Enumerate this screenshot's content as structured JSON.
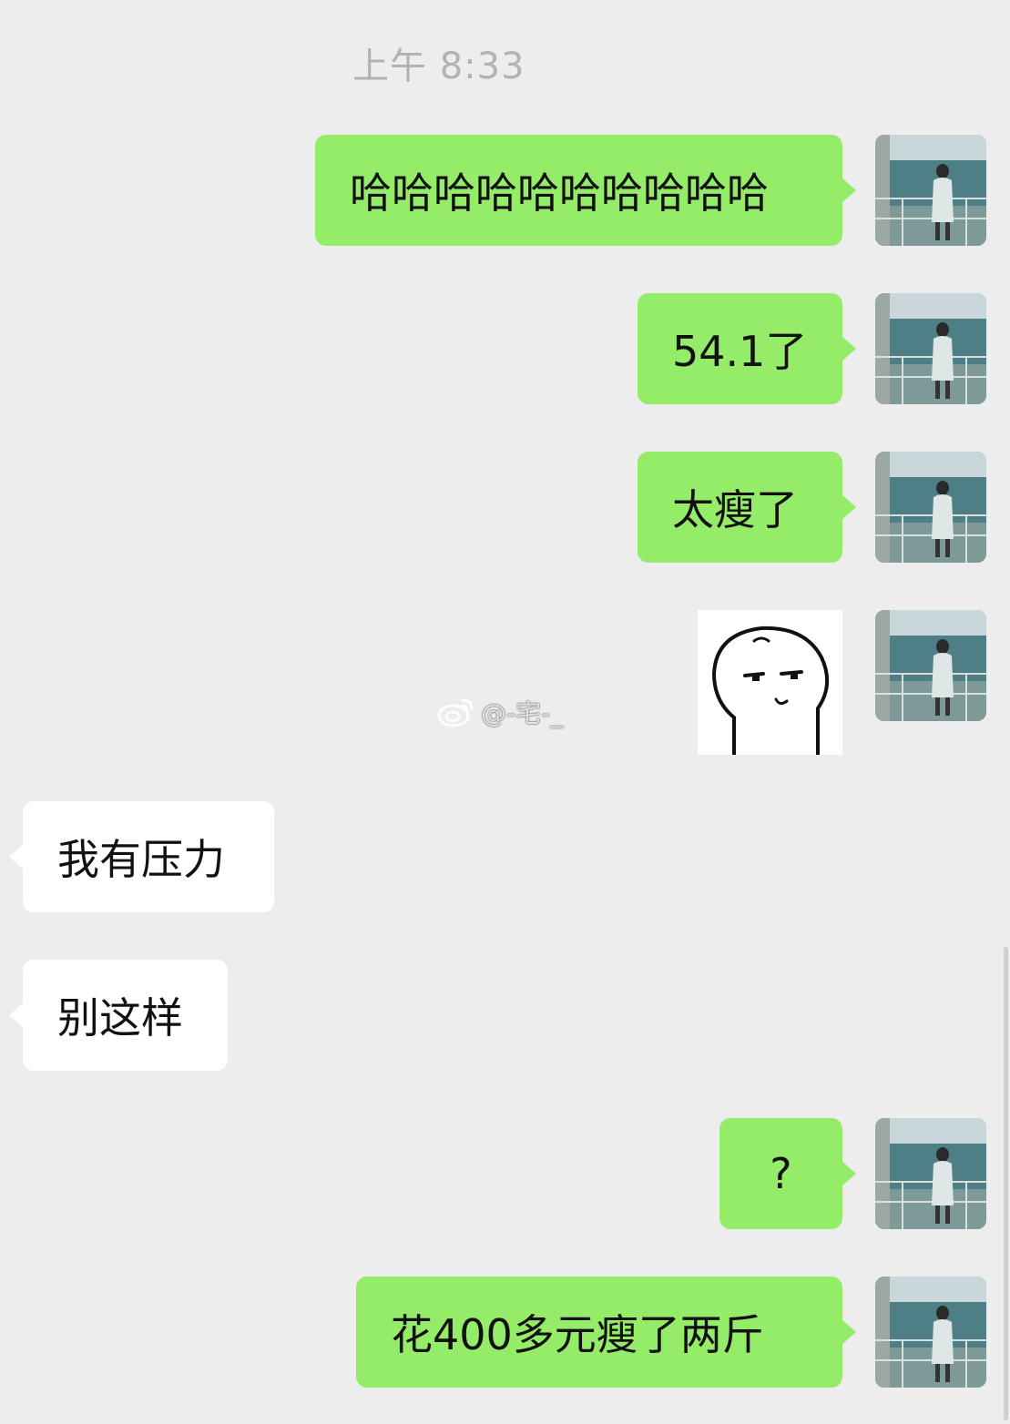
{
  "chat": {
    "timestamp": "上午 8:33",
    "messages": [
      {
        "sender": "me",
        "type": "text",
        "text": "哈哈哈哈哈哈哈哈哈哈"
      },
      {
        "sender": "me",
        "type": "text",
        "text": "54.1了"
      },
      {
        "sender": "me",
        "type": "text",
        "text": "太瘦了"
      },
      {
        "sender": "me",
        "type": "sticker",
        "icon": "smirk-face-sticker"
      },
      {
        "sender": "them",
        "type": "text",
        "text": "我有压力"
      },
      {
        "sender": "them",
        "type": "text",
        "text": "别这样"
      },
      {
        "sender": "me",
        "type": "text",
        "text": "?"
      },
      {
        "sender": "me",
        "type": "text",
        "text": "花400多元瘦了两斤"
      }
    ]
  },
  "watermark": {
    "text": "@-宅-_",
    "icon": "weibo-logo-icon"
  },
  "colors": {
    "background": "#ededed",
    "bubble_me": "#95ec69",
    "bubble_them": "#ffffff",
    "timestamp": "#b2b2b2"
  }
}
